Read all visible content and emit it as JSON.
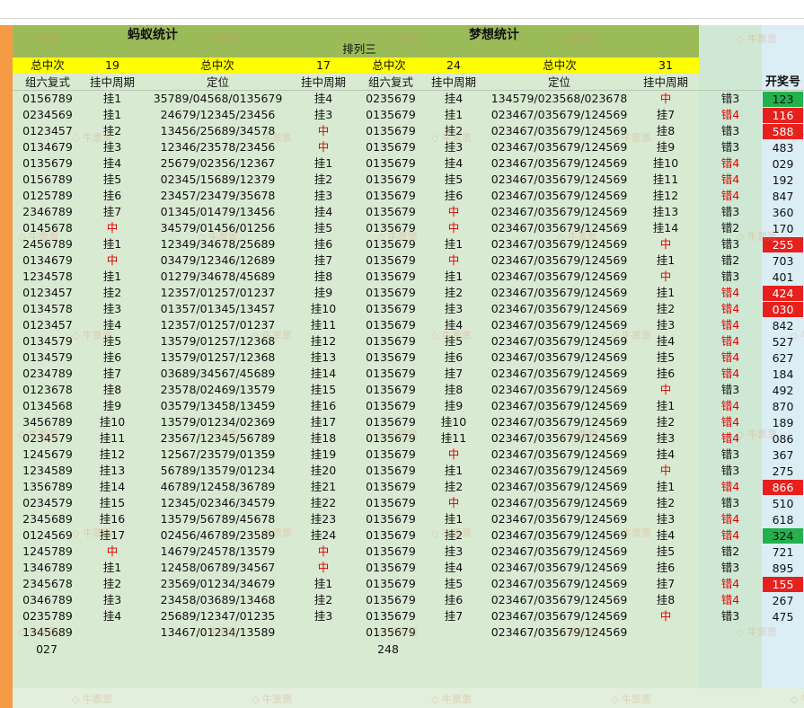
{
  "headers": {
    "title_left": "蚂蚁统计",
    "title_right": "梦想统计",
    "subtitle": "排列三",
    "total_label": "总中次",
    "total_values": [
      "19",
      "17",
      "24",
      "31"
    ],
    "cols": [
      "组六复式",
      "挂中周期",
      "定位",
      "挂中周期",
      "组六复式",
      "挂中周期",
      "定位",
      "挂中周期"
    ],
    "prize_header": "开奖号"
  },
  "rows": [
    [
      "0156789",
      "挂1",
      "35789/04568/0135679",
      "挂4",
      "0235679",
      "挂4",
      "134579/023568/023678",
      "中",
      "错3",
      "123"
    ],
    [
      "0234569",
      "挂1",
      "24679/12345/23456",
      "挂3",
      "0135679",
      "挂1",
      "023467/035679/124569",
      "挂7",
      "错4",
      "116"
    ],
    [
      "0123457",
      "挂2",
      "13456/25689/34578",
      "中",
      "0135679",
      "挂2",
      "023467/035679/124569",
      "挂8",
      "错3",
      "588"
    ],
    [
      "0134679",
      "挂3",
      "12346/23578/23456",
      "中",
      "0135679",
      "挂3",
      "023467/035679/124569",
      "挂9",
      "错3",
      "483"
    ],
    [
      "0135679",
      "挂4",
      "25679/02356/12367",
      "挂1",
      "0135679",
      "挂4",
      "023467/035679/124569",
      "挂10",
      "错4",
      "029"
    ],
    [
      "0156789",
      "挂5",
      "02345/15689/12379",
      "挂2",
      "0135679",
      "挂5",
      "023467/035679/124569",
      "挂11",
      "错4",
      "192"
    ],
    [
      "0125789",
      "挂6",
      "23457/23479/35678",
      "挂3",
      "0135679",
      "挂6",
      "023467/035679/124569",
      "挂12",
      "错4",
      "847"
    ],
    [
      "2346789",
      "挂7",
      "01345/01479/13456",
      "挂4",
      "0135679",
      "中",
      "023467/035679/124569",
      "挂13",
      "错3",
      "360"
    ],
    [
      "0145678",
      "中",
      "34579/01456/01256",
      "挂5",
      "0135679",
      "中",
      "023467/035679/124569",
      "挂14",
      "错2",
      "170"
    ],
    [
      "2456789",
      "挂1",
      "12349/34678/25689",
      "挂6",
      "0135679",
      "挂1",
      "023467/035679/124569",
      "中",
      "错3",
      "255"
    ],
    [
      "0134679",
      "中",
      "03479/12346/12689",
      "挂7",
      "0135679",
      "中",
      "023467/035679/124569",
      "挂1",
      "错2",
      "703"
    ],
    [
      "1234578",
      "挂1",
      "01279/34678/45689",
      "挂8",
      "0135679",
      "挂1",
      "023467/035679/124569",
      "中",
      "错3",
      "401"
    ],
    [
      "0123457",
      "挂2",
      "12357/01257/01237",
      "挂9",
      "0135679",
      "挂2",
      "023467/035679/124569",
      "挂1",
      "错4",
      "424"
    ],
    [
      "0134578",
      "挂3",
      "01357/01345/13457",
      "挂10",
      "0135679",
      "挂3",
      "023467/035679/124569",
      "挂2",
      "错4",
      "030"
    ],
    [
      "0123457",
      "挂4",
      "12357/01257/01237",
      "挂11",
      "0135679",
      "挂4",
      "023467/035679/124569",
      "挂3",
      "错4",
      "842"
    ],
    [
      "0134579",
      "挂5",
      "13579/01257/12368",
      "挂12",
      "0135679",
      "挂5",
      "023467/035679/124569",
      "挂4",
      "错4",
      "527"
    ],
    [
      "0134579",
      "挂6",
      "13579/01257/12368",
      "挂13",
      "0135679",
      "挂6",
      "023467/035679/124569",
      "挂5",
      "错4",
      "627"
    ],
    [
      "0234789",
      "挂7",
      "03689/34567/45689",
      "挂14",
      "0135679",
      "挂7",
      "023467/035679/124569",
      "挂6",
      "错4",
      "184"
    ],
    [
      "0123678",
      "挂8",
      "23578/02469/13579",
      "挂15",
      "0135679",
      "挂8",
      "023467/035679/124569",
      "中",
      "错3",
      "492"
    ],
    [
      "0134568",
      "挂9",
      "03579/13458/13459",
      "挂16",
      "0135679",
      "挂9",
      "023467/035679/124569",
      "挂1",
      "错4",
      "870"
    ],
    [
      "3456789",
      "挂10",
      "13579/01234/02369",
      "挂17",
      "0135679",
      "挂10",
      "023467/035679/124569",
      "挂2",
      "错4",
      "189"
    ],
    [
      "0234579",
      "挂11",
      "23567/12345/56789",
      "挂18",
      "0135679",
      "挂11",
      "023467/035679/124569",
      "挂3",
      "错4",
      "086"
    ],
    [
      "1245679",
      "挂12",
      "12567/23579/01359",
      "挂19",
      "0135679",
      "中",
      "023467/035679/124569",
      "挂4",
      "错3",
      "367"
    ],
    [
      "1234589",
      "挂13",
      "56789/13579/01234",
      "挂20",
      "0135679",
      "挂1",
      "023467/035679/124569",
      "中",
      "错3",
      "275"
    ],
    [
      "1356789",
      "挂14",
      "46789/12458/36789",
      "挂21",
      "0135679",
      "挂2",
      "023467/035679/124569",
      "挂1",
      "错4",
      "866"
    ],
    [
      "0234579",
      "挂15",
      "12345/02346/34579",
      "挂22",
      "0135679",
      "中",
      "023467/035679/124569",
      "挂2",
      "错3",
      "510"
    ],
    [
      "2345689",
      "挂16",
      "13579/56789/45678",
      "挂23",
      "0135679",
      "挂1",
      "023467/035679/124569",
      "挂3",
      "错4",
      "618"
    ],
    [
      "0124569",
      "挂17",
      "02456/46789/23589",
      "挂24",
      "0135679",
      "挂2",
      "023467/035679/124569",
      "挂4",
      "错4",
      "324"
    ],
    [
      "1245789",
      "中",
      "14679/24578/13579",
      "中",
      "0135679",
      "挂3",
      "023467/035679/124569",
      "挂5",
      "错2",
      "721"
    ],
    [
      "1346789",
      "挂1",
      "12458/06789/34567",
      "中",
      "0135679",
      "挂4",
      "023467/035679/124569",
      "挂6",
      "错3",
      "895"
    ],
    [
      "2345678",
      "挂2",
      "23569/01234/34679",
      "挂1",
      "0135679",
      "挂5",
      "023467/035679/124569",
      "挂7",
      "错4",
      "155"
    ],
    [
      "0346789",
      "挂3",
      "23458/03689/13468",
      "挂2",
      "0135679",
      "挂6",
      "023467/035679/124569",
      "挂8",
      "错4",
      "267"
    ],
    [
      "0235789",
      "挂4",
      "25689/12347/01235",
      "挂3",
      "0135679",
      "挂7",
      "023467/035679/124569",
      "中",
      "错3",
      "475"
    ],
    [
      "1345689",
      "",
      "13467/01234/13589",
      "",
      "0135679",
      "",
      "023467/035679/124569",
      "",
      "",
      ""
    ]
  ],
  "prize_colors": {
    "123": "g",
    "116": "r",
    "588": "r",
    "255": "r",
    "424": "r",
    "030": "r",
    "866": "r",
    "324": "g",
    "155": "r"
  },
  "footer": {
    "left_value": "027",
    "right_value": "248"
  },
  "watermark": "牛票票",
  "colors": {
    "green_band": "#9bbb59",
    "yellow_band": "#ffff00",
    "sheet_bg": "#d9ead3",
    "prize_bg": "#dbeef6",
    "red_text": "#e00000",
    "prize_green": "#22b14c",
    "prize_red": "#e6201c"
  }
}
